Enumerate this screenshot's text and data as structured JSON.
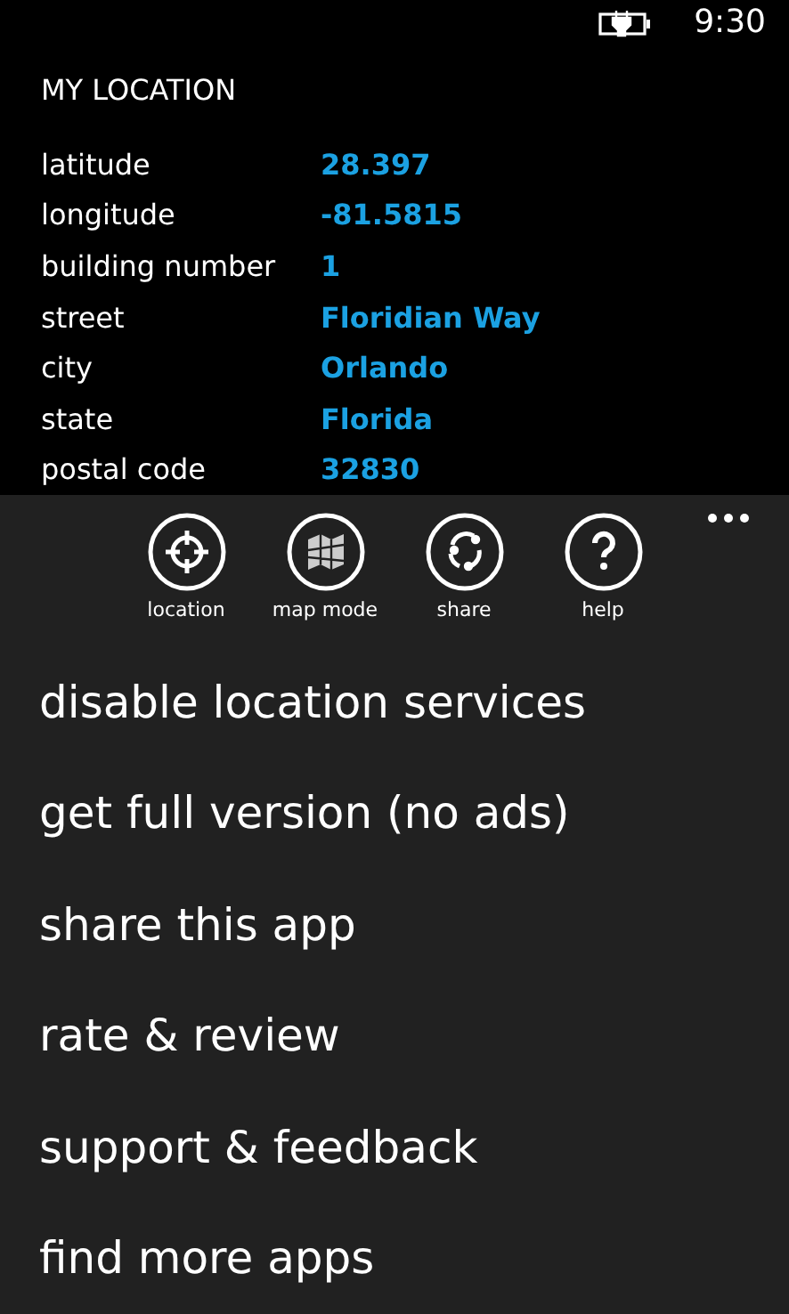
{
  "status_bar": {
    "time": "9:30"
  },
  "title": "MY LOCATION",
  "fields": [
    {
      "label": "latitude",
      "value": "28.397"
    },
    {
      "label": "longitude",
      "value": "-81.5815"
    },
    {
      "label": "building number",
      "value": "1"
    },
    {
      "label": "street",
      "value": "Floridian Way"
    },
    {
      "label": "city",
      "value": "Orlando"
    },
    {
      "label": "state",
      "value": "Florida"
    },
    {
      "label": "postal code",
      "value": "32830"
    }
  ],
  "app_bar": {
    "buttons": [
      {
        "kind": "location",
        "label": "location"
      },
      {
        "kind": "map",
        "label": "map mode"
      },
      {
        "kind": "share",
        "label": "share"
      },
      {
        "kind": "help",
        "label": "help"
      }
    ],
    "menu_items": [
      "disable location services",
      "get full version (no ads)",
      "share this app",
      "rate & review",
      "support & feedback",
      "find more apps"
    ]
  }
}
